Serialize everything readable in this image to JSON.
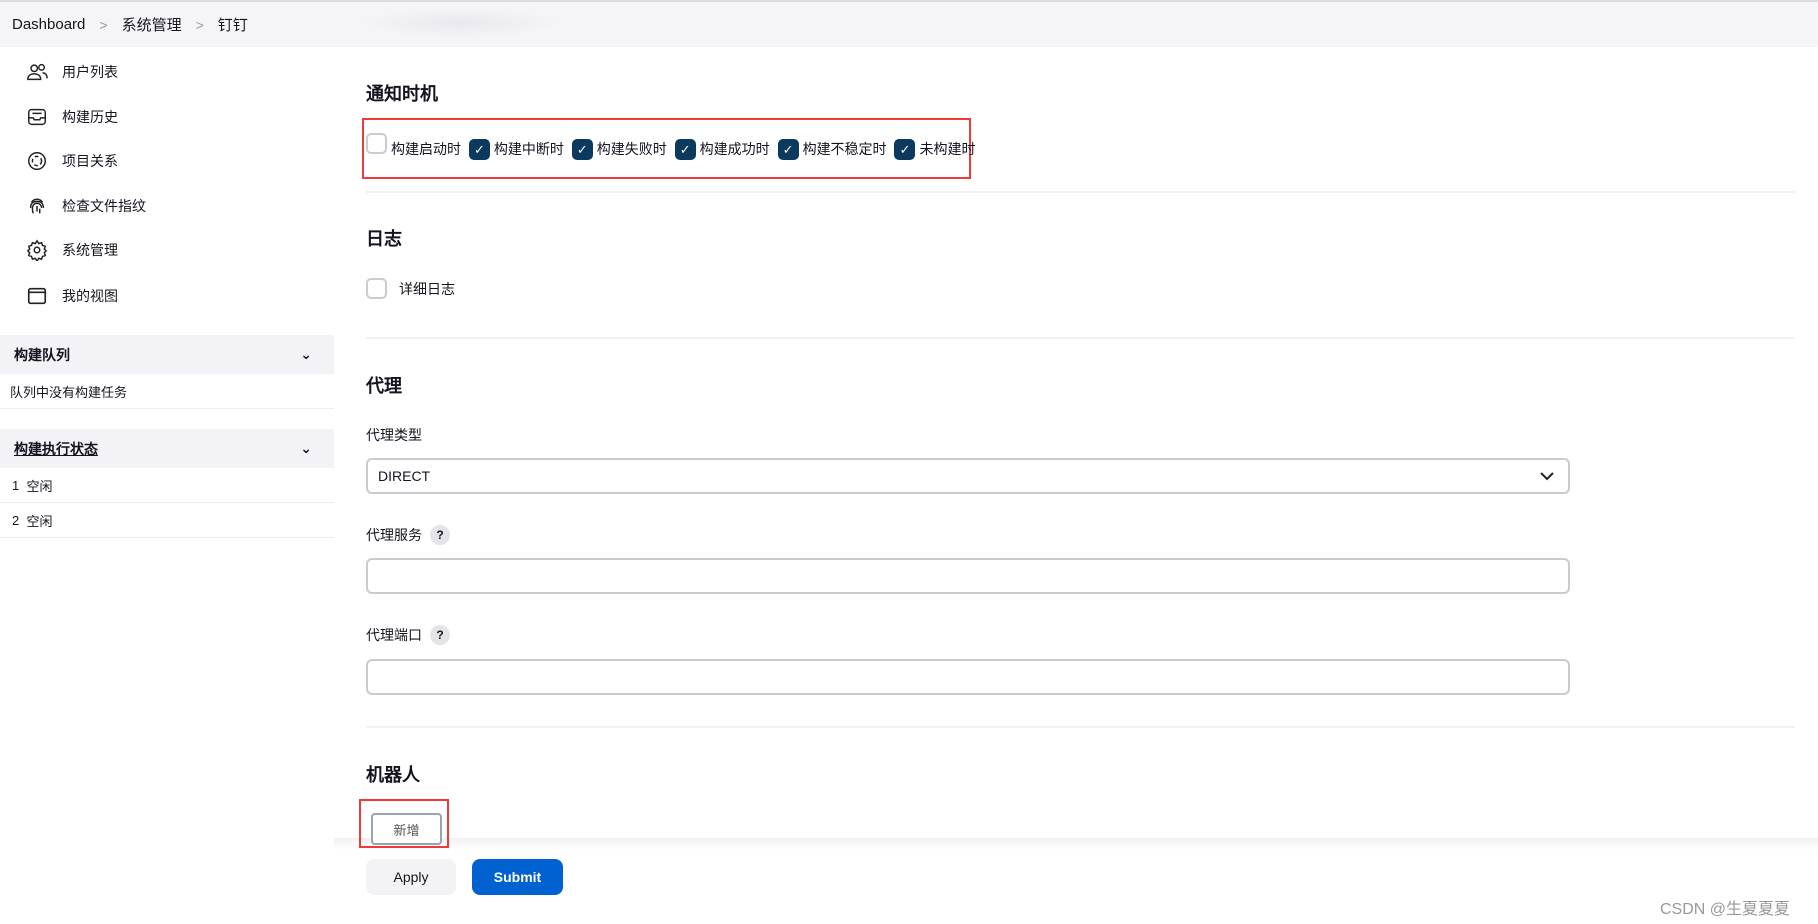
{
  "breadcrumb": [
    "Dashboard",
    "系统管理",
    "钉钉"
  ],
  "sidebar": {
    "items": [
      {
        "label": "用户列表",
        "icon": "users-icon"
      },
      {
        "label": "构建历史",
        "icon": "inbox-icon"
      },
      {
        "label": "项目关系",
        "icon": "relation-icon"
      },
      {
        "label": "检查文件指纹",
        "icon": "fingerprint-icon"
      },
      {
        "label": "系统管理",
        "icon": "gear-icon"
      },
      {
        "label": "我的视图",
        "icon": "window-icon"
      }
    ],
    "queue": {
      "title": "构建队列",
      "empty": "队列中没有构建任务"
    },
    "executors": {
      "title": "构建执行状态",
      "rows": [
        {
          "num": "1",
          "status": "空闲"
        },
        {
          "num": "2",
          "status": "空闲"
        }
      ]
    }
  },
  "main": {
    "notify": {
      "title": "通知时机",
      "options": [
        {
          "label": "构建启动时",
          "checked": false
        },
        {
          "label": "构建中断时",
          "checked": true
        },
        {
          "label": "构建失败时",
          "checked": true
        },
        {
          "label": "构建成功时",
          "checked": true
        },
        {
          "label": "构建不稳定时",
          "checked": true
        },
        {
          "label": "未构建时",
          "checked": true
        }
      ]
    },
    "log": {
      "title": "日志",
      "verbose": "详细日志",
      "checked": false
    },
    "proxy": {
      "title": "代理",
      "type_label": "代理类型",
      "type_value": "DIRECT",
      "server_label": "代理服务",
      "server_value": "",
      "port_label": "代理端口",
      "port_value": "",
      "help": "?"
    },
    "robot": {
      "title": "机器人",
      "add": "新增"
    }
  },
  "footer": {
    "apply": "Apply",
    "submit": "Submit"
  },
  "watermark": "CSDN @生夏夏夏",
  "colors": {
    "accent": "#0062d1",
    "checkbox": "#0b3a5e",
    "highlight": "#f03a3a"
  }
}
